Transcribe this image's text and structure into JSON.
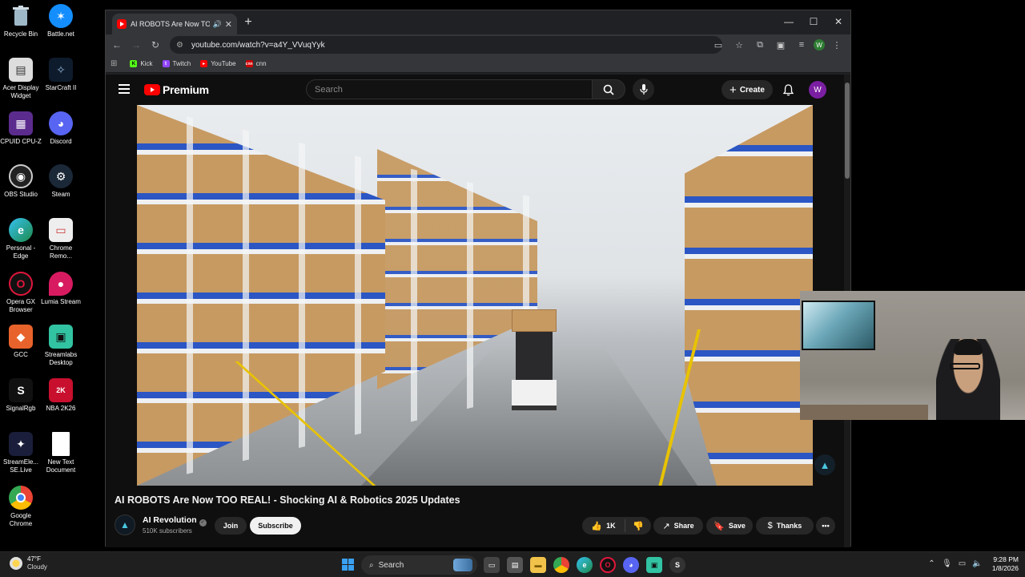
{
  "desktop": {
    "icons_left": [
      {
        "label": "Recycle Bin",
        "icon": "recycle-bin-icon"
      },
      {
        "label": "Acer Display Widget",
        "icon": "acer-display-icon"
      },
      {
        "label": "CPUID CPU-Z",
        "icon": "cpuz-icon"
      },
      {
        "label": "OBS Studio",
        "icon": "obs-icon"
      },
      {
        "label": "Personal - Edge",
        "icon": "edge-icon"
      },
      {
        "label": "Opera GX Browser",
        "icon": "opera-gx-icon"
      },
      {
        "label": "GCC",
        "icon": "gcc-icon"
      },
      {
        "label": "SignalRgb",
        "icon": "signalrgb-icon"
      },
      {
        "label": "StreamEle... SE.Live",
        "icon": "streamelements-icon"
      },
      {
        "label": "Google Chrome",
        "icon": "chrome-icon"
      }
    ],
    "icons_right": [
      {
        "label": "Battle.net",
        "icon": "battlenet-icon"
      },
      {
        "label": "StarCraft II",
        "icon": "starcraft-icon"
      },
      {
        "label": "Discord",
        "icon": "discord-icon"
      },
      {
        "label": "Steam",
        "icon": "steam-icon"
      },
      {
        "label": "Chrome Remo...",
        "icon": "chrome-remote-icon"
      },
      {
        "label": "Lumia Stream",
        "icon": "lumia-icon"
      },
      {
        "label": "Streamlabs Desktop",
        "icon": "streamlabs-icon"
      },
      {
        "label": "NBA 2K26",
        "icon": "nba2k-icon"
      },
      {
        "label": "New Text Document",
        "icon": "text-document-icon"
      }
    ]
  },
  "browser": {
    "tab_title": "AI ROBOTS Are Now TOO R",
    "url": "youtube.com/watch?v=a4Y_VVuqYyk",
    "profile_initial": "W",
    "bookmarks": [
      {
        "label": "Kick",
        "color": "#53fc18"
      },
      {
        "label": "Twitch",
        "color": "#9146ff"
      },
      {
        "label": "YouTube",
        "color": "#ff0000"
      },
      {
        "label": "cnn",
        "color": "#cc0000"
      }
    ]
  },
  "youtube": {
    "logo_text": "Premium",
    "search_placeholder": "Search",
    "create_label": "Create",
    "avatar_initial": "W",
    "video_title": "AI ROBOTS Are Now TOO REAL! - Shocking AI & Robotics 2025 Updates",
    "channel_name": "AI Revolution",
    "subscribers": "510K subscribers",
    "join_label": "Join",
    "subscribe_label": "Subscribe",
    "likes": "1K",
    "share_label": "Share",
    "save_label": "Save",
    "thanks_label": "Thanks"
  },
  "taskbar": {
    "temperature": "47°F",
    "weather": "Cloudy",
    "search_label": "Search",
    "time": "9:28 PM",
    "date": "1/8/2026"
  },
  "colors": {
    "yt_red": "#ff0000",
    "accent_blue": "#3aa0f2"
  }
}
